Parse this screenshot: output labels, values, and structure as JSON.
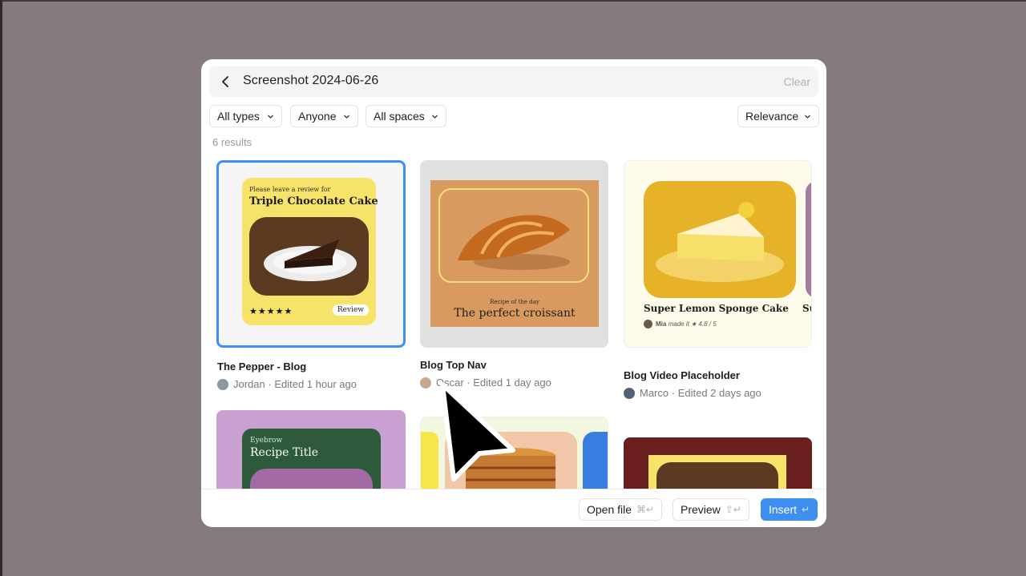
{
  "search": {
    "query": "Screenshot 2024-06-26",
    "clear_label": "Clear"
  },
  "filters": {
    "types": "All types",
    "people": "Anyone",
    "spaces": "All spaces",
    "sort": "Relevance"
  },
  "results_count": "6 results",
  "cards": [
    {
      "title": "The Pepper - Blog",
      "author": "Jordan",
      "edited": "· Edited 1 hour ago",
      "thumb": {
        "eyebrow": "Please leave a review for",
        "heading": "Triple Chocolate Cake",
        "stars": "★★★★★",
        "pill": "Review"
      }
    },
    {
      "title": "Blog Top Nav",
      "author": "Oscar",
      "edited": "· Edited 1 day ago",
      "thumb": {
        "eyebrow": "Recipe of the day",
        "heading": "The perfect croissant"
      }
    },
    {
      "title": "Blog Video Placeholder",
      "author": "Marco",
      "edited": "· Edited 2 days ago",
      "thumb": {
        "heading": "Super Lemon Sponge Cake",
        "user": "Mia",
        "made": "made it ★ 4.8 / 5",
        "cut_heading": "Su"
      }
    },
    {
      "thumb": {
        "eyebrow": "Eyebrow",
        "heading": "Recipe Title"
      }
    },
    {
      "thumb": {}
    },
    {
      "thumb": {}
    }
  ],
  "footer": {
    "open_label": "Open file",
    "open_kbd": "⌘↵",
    "preview_label": "Preview",
    "preview_kbd": "⇧↵",
    "insert_label": "Insert",
    "insert_kbd": "↵"
  },
  "colors": {
    "accent": "#3d8ff0",
    "backdrop": "#857a7c"
  }
}
